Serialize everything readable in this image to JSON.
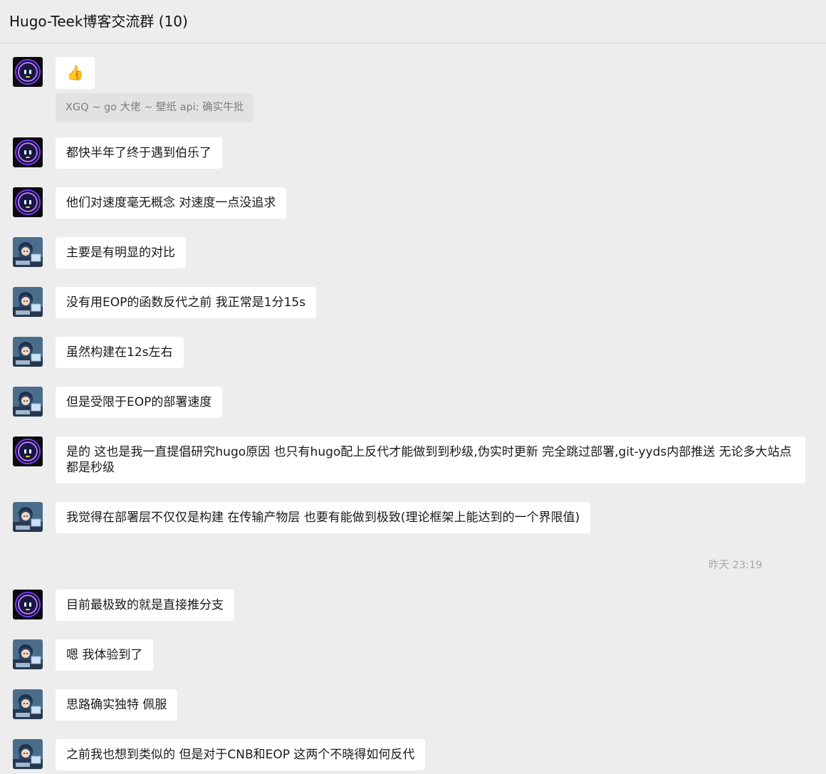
{
  "window": {
    "title": "Hugo-Teek博客交流群 (10)"
  },
  "timestamp": "昨天 23:19",
  "messages": [
    {
      "sender": "robot",
      "text": "👍",
      "quote": "XGQ ~ go 大佬 ~ 壁纸 api: 确实牛批"
    },
    {
      "sender": "robot",
      "text": "都快半年了终于遇到伯乐了"
    },
    {
      "sender": "robot",
      "text": "他们对速度毫无概念 对速度一点没追求"
    },
    {
      "sender": "anime",
      "text": "主要是有明显的对比"
    },
    {
      "sender": "anime",
      "text": "没有用EOP的函数反代之前  我正常是1分15s"
    },
    {
      "sender": "anime",
      "text": "虽然构建在12s左右"
    },
    {
      "sender": "anime",
      "text": "但是受限于EOP的部署速度"
    },
    {
      "sender": "robot",
      "text": "是的 这也是我一直提倡研究hugo原因 也只有hugo配上反代才能做到到秒级,伪实时更新 完全跳过部署,git-yyds内部推送 无论多大站点都是秒级"
    },
    {
      "sender": "anime",
      "text": "我觉得在部署层不仅仅是构建 在传输产物层 也要有能做到极致(理论框架上能达到的一个界限值)"
    },
    {
      "sender": "robot",
      "text": "目前最极致的就是直接推分支"
    },
    {
      "sender": "anime",
      "text": "嗯 我体验到了"
    },
    {
      "sender": "anime",
      "text": "思路确实独特 佩服"
    },
    {
      "sender": "anime",
      "text": "之前我也想到类似的 但是对于CNB和EOP 这两个不晓得如何反代"
    }
  ],
  "colors": {
    "background": "#ededed",
    "bubble": "#ffffff",
    "quote_bg": "#e2e2e2",
    "timestamp": "#a8a8a8"
  },
  "icons": {
    "robot": "robot-avatar-icon",
    "anime": "anime-avatar-icon"
  }
}
